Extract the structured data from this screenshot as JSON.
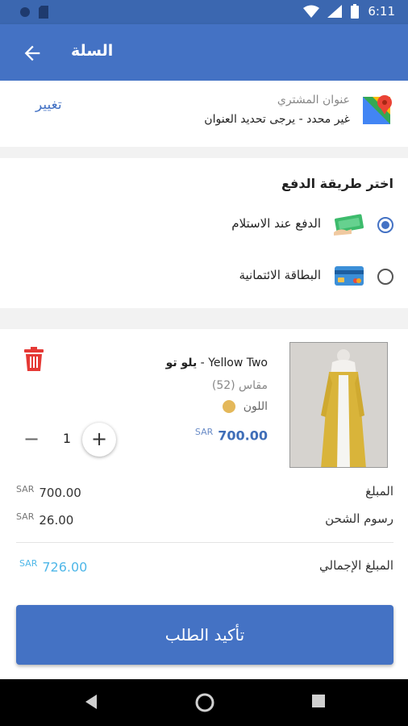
{
  "status": {
    "time": "6:11"
  },
  "appbar": {
    "title": "السلة"
  },
  "address": {
    "label": "عنوان المشتري",
    "value": "غير محدد - يرجى تحديد العنوان",
    "change_label": "تغيير"
  },
  "payment": {
    "title": "اختر طريقة الدفع",
    "options": [
      {
        "label": "الدفع عند الاستلام",
        "selected": true,
        "icon": "cash-icon"
      },
      {
        "label": "البطاقة الائتمانية",
        "selected": false,
        "icon": "credit-card-icon"
      }
    ]
  },
  "item": {
    "name_en": "Yellow Two - ",
    "name_ar": "يلو تو",
    "size": "مقاس (52)",
    "color_label": "اللون",
    "color": "#e4b85a",
    "currency": "SAR",
    "price": "700.00",
    "quantity": "1"
  },
  "summary": {
    "amount_label": "المبلغ",
    "amount_currency": "SAR",
    "amount_value": "700.00",
    "shipping_label": "رسوم الشحن",
    "shipping_currency": "SAR",
    "shipping_value": "26.00",
    "total_label": "المبلغ الإجمالي",
    "total_currency": "SAR",
    "total_value": "726.00"
  },
  "confirm_label": "تأكيد الطلب",
  "colors": {
    "primary": "#4472c4",
    "statusbar": "#3b67b0",
    "total": "#4fb7e8"
  }
}
